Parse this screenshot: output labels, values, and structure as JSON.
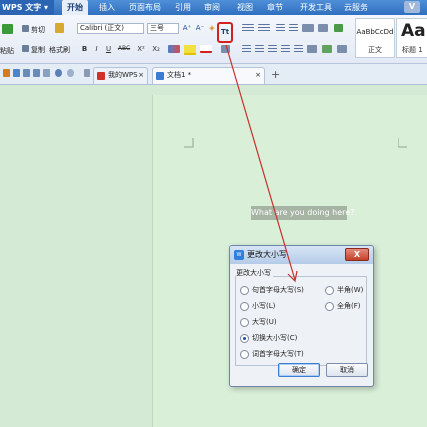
{
  "app": {
    "title": "WPS 文字",
    "dropdown_icon": "chevron-down-icon"
  },
  "menu": {
    "tabs": [
      {
        "label": "开始",
        "active": true
      },
      {
        "label": "插入"
      },
      {
        "label": "页面布局"
      },
      {
        "label": "引用"
      },
      {
        "label": "审阅"
      },
      {
        "label": "视图"
      },
      {
        "label": "章节"
      },
      {
        "label": "开发工具"
      },
      {
        "label": "云服务"
      }
    ],
    "corner_button": "V"
  },
  "ribbon": {
    "clipboard": {
      "paste": "粘贴",
      "cut": "剪切",
      "copy": "复制",
      "format_painter": "格式刷"
    },
    "font": {
      "name": "Calibri (正文)",
      "size": "三号",
      "bold": "B",
      "italic": "I",
      "underline": "U",
      "strike": "ABC",
      "superscript": "X²",
      "subscript": "X₂",
      "grow": "A⁺",
      "shrink": "A⁻",
      "clear": "◈",
      "change_case": "Tt"
    },
    "styles": [
      {
        "sample": "AaBbCcDd",
        "name": "正文"
      },
      {
        "sample": "AaB",
        "name": "标题 1"
      }
    ]
  },
  "doc_tabs": [
    {
      "label": "我的WPS",
      "close": "×"
    },
    {
      "label": "文档1 *",
      "close": "×"
    }
  ],
  "new_tab": "+",
  "document": {
    "selected_text": "What are you doing here?"
  },
  "dialog": {
    "icon_text": "W",
    "title": "更改大小写",
    "close": "X",
    "group_label": "更改大小写",
    "options": [
      {
        "label": "句首字母大写(S)",
        "checked": false
      },
      {
        "label": "小写(L)",
        "checked": false
      },
      {
        "label": "大写(U)",
        "checked": false
      },
      {
        "label": "切换大小写(C)",
        "checked": true
      },
      {
        "label": "词首字母大写(T)",
        "checked": false
      }
    ],
    "options_right": [
      {
        "label": "半角(W)",
        "checked": false
      },
      {
        "label": "全角(F)",
        "checked": false
      }
    ],
    "ok": "确定",
    "cancel": "取消"
  },
  "colors": {
    "accent": "#2f6fbf",
    "annotation": "#d52020",
    "background": "#d9ecd9"
  }
}
